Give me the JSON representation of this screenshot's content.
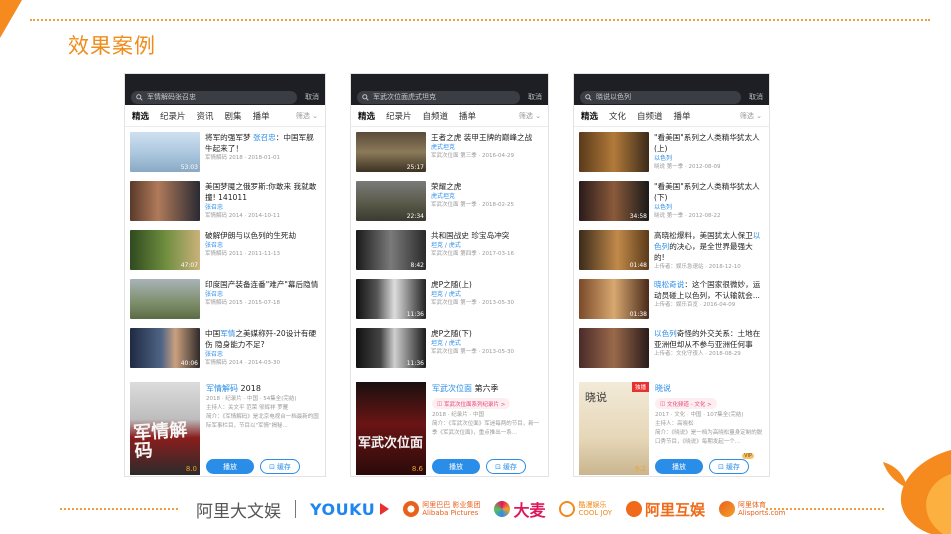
{
  "slide": {
    "title": "效果案例"
  },
  "colors": {
    "accent_orange": "#f08c1a",
    "link_blue": "#2a8de8",
    "dark_bar": "#1d1f24"
  },
  "phones": [
    {
      "search": "军情解码张召忠",
      "cancel": "取消",
      "tabs": [
        "精选",
        "纪录片",
        "资讯",
        "剧集",
        "播单"
      ],
      "filter": "筛选",
      "items": [
        {
          "title_parts": [
            "将军的强军梦 ",
            "张召忠",
            "：中国军舰牛起来了！"
          ],
          "tag": "",
          "sub": "军情解码 2018 · 2018-01-01",
          "dur": "53:03"
        },
        {
          "title_parts": [
            "美国梦魇之俄罗斯:你敢来 我就敢撞! 141011",
            "",
            ""
          ],
          "tag": "张召忠",
          "sub": "军情解码 2014 · 2014-10-11",
          "dur": ""
        },
        {
          "title_parts": [
            "破解伊朗与以色列的生死劫",
            "",
            ""
          ],
          "tag": "张召忠",
          "sub": "军情解码 2011 · 2011-11-13",
          "dur": "47:07"
        },
        {
          "title_parts": [
            "印度国产装备连番\"难产\"幕后隐情",
            "",
            ""
          ],
          "tag": "张召忠",
          "sub": "军情解码 2015 · 2015-07-18",
          "dur": ""
        },
        {
          "title_parts": [
            "中国",
            "军情",
            "之美媒称歼-20设计有硬伤 隐身能力不足?"
          ],
          "tag": "张召忠",
          "sub": "军情解码 2014 · 2014-03-30",
          "dur": "40:06"
        }
      ],
      "big": {
        "title_blue": "军情解码",
        "title_plain": " 2018",
        "pill": "",
        "lines": [
          "2018 · 纪录片 · 中国 · 54集全(完结)",
          "主持人：关文平 范荣 邬辉祥 罗雁",
          "简介：《军情解码》是北京电视台一档最新的国际军事栏目，节目以\"军情\"揭秘..."
        ],
        "poster_text": "军情解码",
        "rating": "8.0",
        "badge": "",
        "play": "播放",
        "cache": "缓存",
        "vip": ""
      }
    },
    {
      "search": "军武次位面虎式坦克",
      "cancel": "取消",
      "tabs": [
        "精选",
        "纪录片",
        "自频道",
        "播单"
      ],
      "filter": "筛选",
      "items": [
        {
          "title_parts": [
            "王者之虎 装甲王牌的巅峰之战",
            "",
            ""
          ],
          "tag": "虎式坦克",
          "sub": "军武次位面 第三季 · 2016-04-29",
          "dur": "25:17"
        },
        {
          "title_parts": [
            "荣耀之虎",
            "",
            ""
          ],
          "tag": "虎式坦克",
          "sub": "军武次位面 第一季 · 2018-02-25",
          "dur": "22:34"
        },
        {
          "title_parts": [
            "共和国战史 珍宝岛冲突",
            "",
            ""
          ],
          "tag": "坦克 / 虎式",
          "sub": "军武次位面 第四季 · 2017-03-16",
          "dur": "8:42"
        },
        {
          "title_parts": [
            "虎P之随(上)",
            "",
            ""
          ],
          "tag": "坦克 / 虎式",
          "sub": "军武次位面 第一季 · 2013-05-30",
          "dur": "11:36"
        },
        {
          "title_parts": [
            "虎P之随(下)",
            "",
            ""
          ],
          "tag": "坦克 / 虎式",
          "sub": "军武次位面 第一季 · 2013-05-30",
          "dur": "11:36"
        }
      ],
      "big": {
        "title_blue": "军武次位面",
        "title_plain": " 第六季",
        "pill": "军武次位面系列纪录片 >",
        "lines": [
          "2018 · 纪录片 · 中国",
          "简介：《军武次位面》军迷每两的节目，新一季《军武次位面》，重点推出一系..."
        ],
        "poster_text": "军武次位面",
        "rating": "8.6",
        "badge": "",
        "play": "播放",
        "cache": "缓存",
        "vip": ""
      }
    },
    {
      "search": "晓说以色列",
      "cancel": "取消",
      "tabs": [
        "精选",
        "文化",
        "自频道",
        "播单"
      ],
      "filter": "筛选",
      "items": [
        {
          "title_parts": [
            "\"看美国\"系列之人类精华犹太人(上)",
            "",
            ""
          ],
          "tag": "以色列",
          "sub": "晓说 第一季 · 2012-08-09",
          "dur": ""
        },
        {
          "title_parts": [
            "\"看美国\"系列之人类精华犹太人(下)",
            "",
            ""
          ],
          "tag": "以色列",
          "sub": "晓说 第一季 · 2012-08-22",
          "dur": "34:58"
        },
        {
          "title_parts": [
            "高晓松爆料，美国犹太人保卫",
            "以色列",
            "的决心，是全世界最强大的!"
          ],
          "tag": "",
          "sub": "上传者：娱乐急速站 · 2018-12-10",
          "dur": "01:48"
        },
        {
          "title_parts": [
            "晓",
            "松奇说",
            "：这个国家很微妙，运动员碰上以色列，不认输就会..."
          ],
          "tag": "",
          "sub": "上传者：娱乐百览 · 2016-04-09",
          "dur": "01:38"
        },
        {
          "title_parts": [
            "以色列",
            "奇怪的外交关系：土地在亚洲但却从不参与亚洲任何事",
            ""
          ],
          "tag": "",
          "sub": "上传者：文化守夜人 · 2018-08-29",
          "dur": ""
        }
      ],
      "big": {
        "title_blue": "晓说",
        "title_plain": "",
        "pill": "文化频道 - 文化 >",
        "lines": [
          "2017 · 文化 · 中国 · 107集全(完结)",
          "主持人：高晓松",
          "简介：《晓说》是一档为高晓松量身定制的脱口秀节目，《晓说》每期发起一个..."
        ],
        "poster_text": "晓说",
        "rating": "9.2",
        "badge": "独播",
        "play": "播放",
        "cache": "缓存",
        "vip": "VIP"
      }
    }
  ],
  "logos": {
    "dawenyu": "阿里大文娱",
    "youku": "YOUKU",
    "pictures_cn": "阿里巴巴 影业集团",
    "pictures_en": "Alibaba Pictures",
    "damai": "大麦",
    "kuaile": "酷漫娱乐",
    "kuaile_en": "COOL JOY",
    "hudong": "阿里互娱",
    "tiyu": "阿里体育",
    "tiyu_en": "Alisports.com"
  }
}
